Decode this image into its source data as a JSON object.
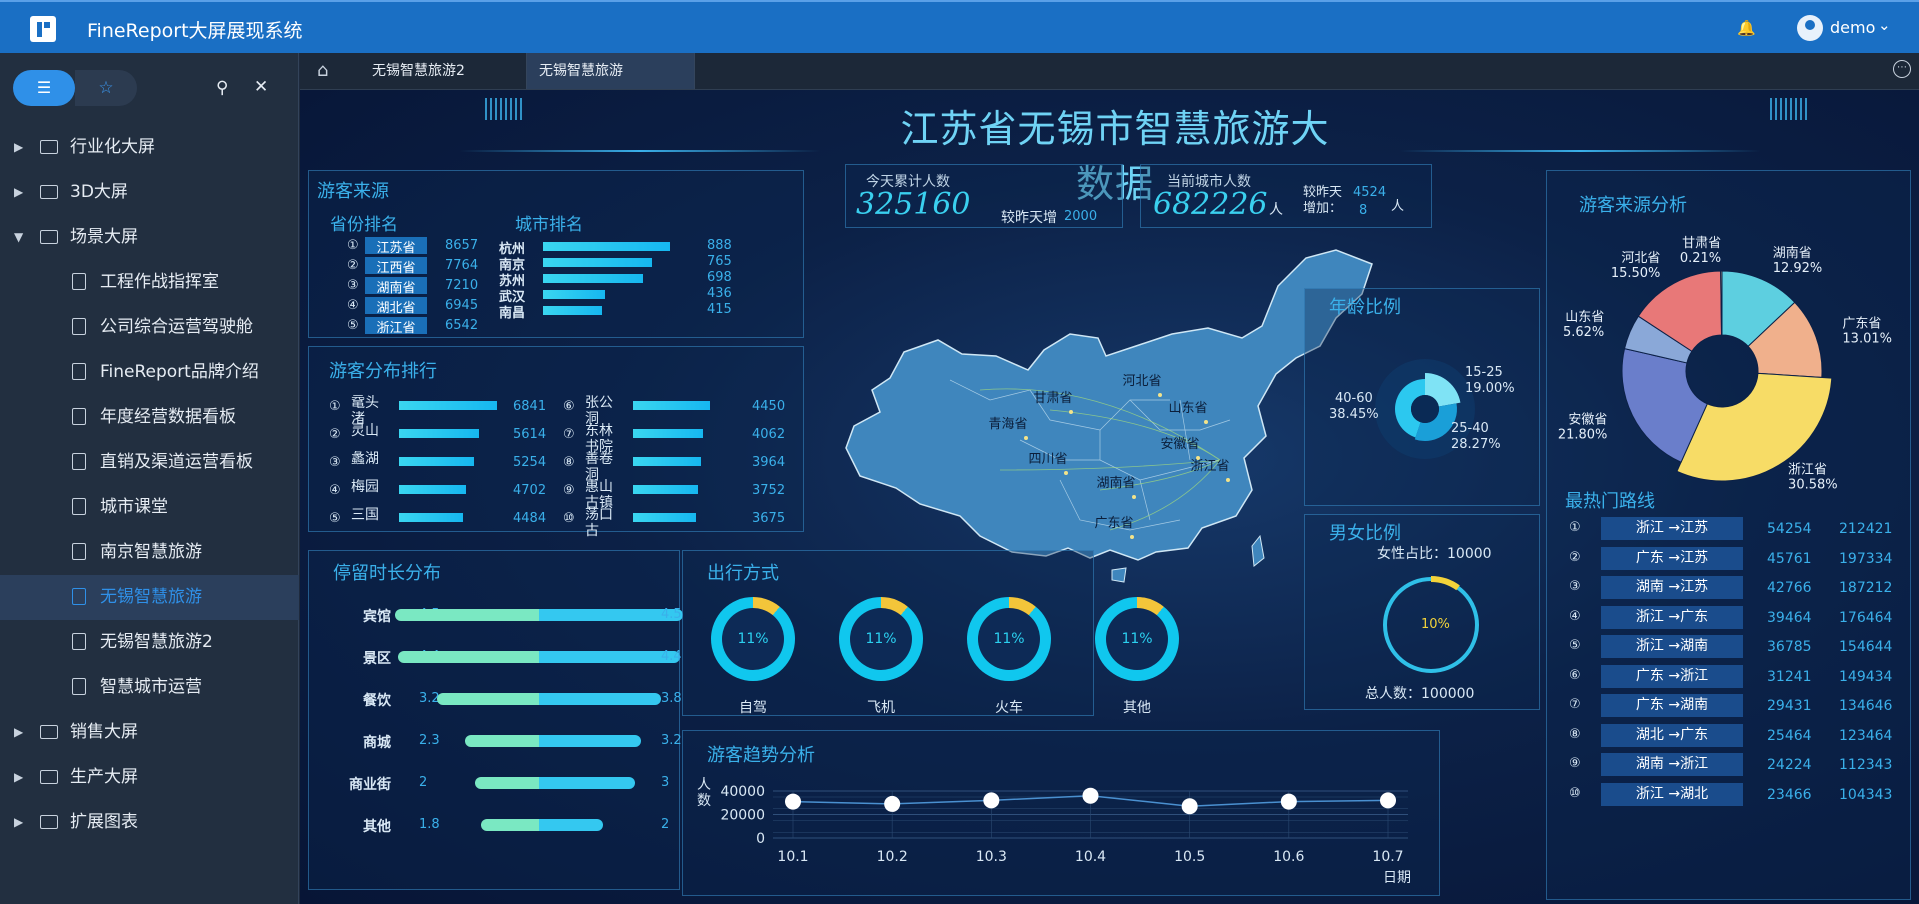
{
  "app": {
    "title": "FineReport大屏展现系统",
    "user": "demo"
  },
  "sidebar": {
    "items": [
      {
        "label": "行业化大屏"
      },
      {
        "label": "3D大屏"
      },
      {
        "label": "场景大屏"
      },
      {
        "label": "工程作战指挥室"
      },
      {
        "label": "公司综合运营驾驶舱"
      },
      {
        "label": "FineReport品牌介绍"
      },
      {
        "label": "年度经营数据看板"
      },
      {
        "label": "直销及渠道运营看板"
      },
      {
        "label": "城市课堂"
      },
      {
        "label": "南京智慧旅游"
      },
      {
        "label": "无锡智慧旅游"
      },
      {
        "label": "无锡智慧旅游2"
      },
      {
        "label": "智慧城市运营"
      },
      {
        "label": "销售大屏"
      },
      {
        "label": "生产大屏"
      },
      {
        "label": "扩展图表"
      }
    ]
  },
  "tabs": [
    {
      "label": "无锡智慧旅游2"
    },
    {
      "label": "无锡智慧旅游"
    }
  ],
  "dashboard": {
    "title": "江苏省无锡市智慧旅游大数据",
    "source": {
      "title": "游客来源",
      "province_title": "省份排名",
      "city_title": "城市排名",
      "provinces": [
        {
          "rank": "①",
          "name": "江苏省",
          "value": "8657"
        },
        {
          "rank": "②",
          "name": "江西省",
          "value": "7764"
        },
        {
          "rank": "③",
          "name": "湖南省",
          "value": "7210"
        },
        {
          "rank": "④",
          "name": "湖北省",
          "value": "6945"
        },
        {
          "rank": "⑤",
          "name": "浙江省",
          "value": "6542"
        }
      ],
      "cities": [
        {
          "name": "杭州",
          "value": 888
        },
        {
          "name": "南京",
          "value": 765
        },
        {
          "name": "苏州",
          "value": 698
        },
        {
          "name": "武汉",
          "value": 436
        },
        {
          "name": "南昌",
          "value": 415
        }
      ]
    },
    "distribution": {
      "title": "游客分布排行",
      "left": [
        {
          "rank": "①",
          "name": "鼋头渚",
          "value": 6841
        },
        {
          "rank": "②",
          "name": "灵山",
          "value": 5614
        },
        {
          "rank": "③",
          "name": "蠡湖",
          "value": 5254
        },
        {
          "rank": "④",
          "name": "梅园",
          "value": 4702
        },
        {
          "rank": "⑤",
          "name": "三国",
          "value": 4484
        }
      ],
      "right": [
        {
          "rank": "⑥",
          "name": "张公洞",
          "value": 4450
        },
        {
          "rank": "⑦",
          "name": "东林书院",
          "value": 4062
        },
        {
          "rank": "⑧",
          "name": "善卷洞",
          "value": 3964
        },
        {
          "rank": "⑨",
          "name": "惠山古镇",
          "value": 3752
        },
        {
          "rank": "⑩",
          "name": "荡口古",
          "value": 3675
        }
      ]
    },
    "today": {
      "label": "今天累计人数",
      "value": "325160",
      "inc_label": "较昨天增",
      "inc_value": "2000"
    },
    "current": {
      "label": "当前城市人数",
      "value": "682226",
      "unit": "人",
      "inc_label": "较昨天增加：",
      "inc_value": "4524",
      "inc_value2": "8",
      "inc_unit": "人"
    },
    "map_labels": [
      "甘肃省",
      "河北省",
      "山东省",
      "青海省",
      "安徽省",
      "四川省",
      "浙江省",
      "湖南省",
      "广东省"
    ],
    "age": {
      "title": "年龄比例",
      "segments": [
        {
          "label": "15-25",
          "pct": "19.00%",
          "value": 19.0,
          "color": "#7fe3f5"
        },
        {
          "label": "25-40",
          "pct": "28.27%",
          "value": 28.27,
          "color": "#1a9fd8"
        },
        {
          "label": "40-60",
          "pct": "38.45%",
          "value": 38.45,
          "color": "#2cc8ef"
        }
      ]
    },
    "gender": {
      "title": "男女比例",
      "female": "女性占比：10000",
      "pct": "10%",
      "pct_value": 10,
      "total": "总人数：100000"
    },
    "pie": {
      "title": "游客来源分析",
      "slices": [
        {
          "name": "湖南省",
          "pct": "12.92%",
          "value": 12.92,
          "color": "#5dcfe0"
        },
        {
          "name": "广东省",
          "pct": "13.01%",
          "value": 13.01,
          "color": "#f0b08c"
        },
        {
          "name": "浙江省",
          "pct": "30.58%",
          "value": 30.58,
          "color": "#f7dc66"
        },
        {
          "name": "安徽省",
          "pct": "21.80%",
          "value": 21.8,
          "color": "#6a7ecb"
        },
        {
          "name": "山东省",
          "pct": "5.62%",
          "value": 5.62,
          "color": "#8aa8d8"
        },
        {
          "name": "河北省",
          "pct": "15.50%",
          "value": 15.5,
          "color": "#e87878"
        },
        {
          "name": "甘肃省",
          "pct": "0.21%",
          "value": 0.21,
          "color": "#d9c8a0"
        }
      ]
    },
    "routes": {
      "title": "最热门路线",
      "rows": [
        {
          "rank": "①",
          "route": "浙江 →江苏",
          "a": "54254",
          "b": "212421"
        },
        {
          "rank": "②",
          "route": "广东 →江苏",
          "a": "45761",
          "b": "197334"
        },
        {
          "rank": "③",
          "route": "湖南 →江苏",
          "a": "42766",
          "b": "187212"
        },
        {
          "rank": "④",
          "route": "浙江 →广东",
          "a": "39464",
          "b": "176464"
        },
        {
          "rank": "⑤",
          "route": "浙江 →湖南",
          "a": "36785",
          "b": "154644"
        },
        {
          "rank": "⑥",
          "route": "广东 →浙江",
          "a": "31241",
          "b": "149434"
        },
        {
          "rank": "⑦",
          "route": "广东 →湖南",
          "a": "29431",
          "b": "134646"
        },
        {
          "rank": "⑧",
          "route": "湖北 →广东",
          "a": "25464",
          "b": "123464"
        },
        {
          "rank": "⑨",
          "route": "湖南 →浙江",
          "a": "24224",
          "b": "112343"
        },
        {
          "rank": "⑩",
          "route": "浙江 →湖北",
          "a": "23466",
          "b": "104343"
        }
      ]
    },
    "stay": {
      "title": "停留时长分布",
      "rows": [
        {
          "name": "宾馆",
          "left": 4.5,
          "right": 4.5,
          "left_label": "4.5",
          "right_label": "4.5"
        },
        {
          "name": "景区",
          "left": 4.4,
          "right": 4.4,
          "left_label": "4.4",
          "right_label": "4.4"
        },
        {
          "name": "餐饮",
          "left": 3.2,
          "right": 3.8,
          "left_label": "3.2",
          "right_label": "3.8"
        },
        {
          "name": "商城",
          "left": 2.3,
          "right": 3.2,
          "left_label": "2.3",
          "right_label": "3.2"
        },
        {
          "name": "商业街",
          "left": 2,
          "right": 3,
          "left_label": "2",
          "right_label": "3"
        },
        {
          "name": "其他",
          "left": 1.8,
          "right": 2,
          "left_label": "1.8",
          "right_label": "2"
        }
      ]
    },
    "travel": {
      "title": "出行方式",
      "modes": [
        {
          "name": "自驾",
          "pct": "11%",
          "value": 11
        },
        {
          "name": "飞机",
          "pct": "11%",
          "value": 11
        },
        {
          "name": "火车",
          "pct": "11%",
          "value": 11
        },
        {
          "name": "其他",
          "pct": "11%",
          "value": 11
        }
      ]
    },
    "trend": {
      "title": "游客趋势分析",
      "ylabel": "人数",
      "xlabel": "日期"
    }
  },
  "chart_data": {
    "type": "line",
    "x": [
      "10.1",
      "10.2",
      "10.3",
      "10.4",
      "10.5",
      "10.6",
      "10.7"
    ],
    "series": [
      {
        "values": [
          31000,
          29000,
          32000,
          36000,
          27000,
          31000,
          32000
        ]
      }
    ],
    "ylim": [
      0,
      40000
    ],
    "yticks": [
      "40000",
      "20000",
      "0"
    ],
    "xlabel": "日期",
    "ylabel": "人数"
  }
}
